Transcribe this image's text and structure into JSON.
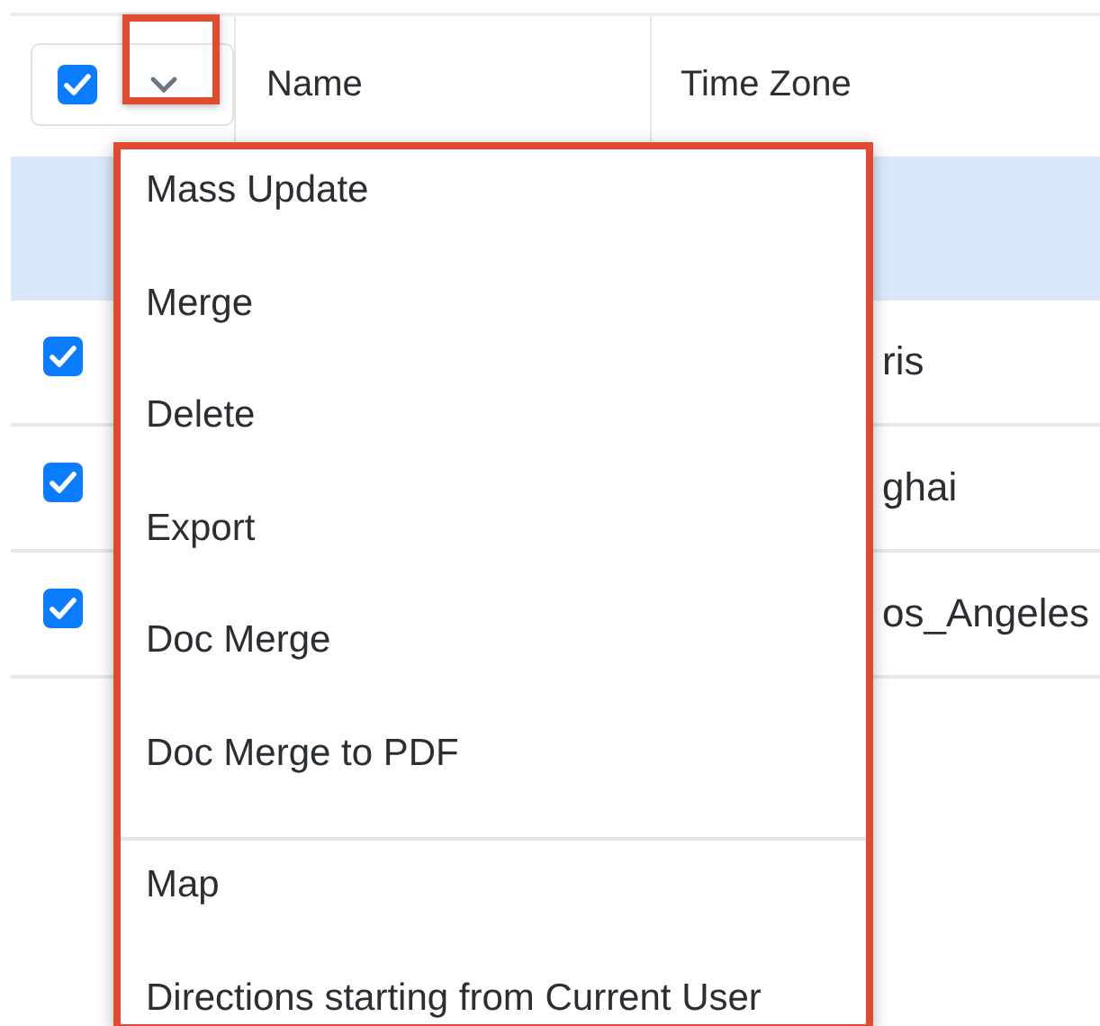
{
  "header": {
    "select_all": {
      "checked": true
    },
    "columns": [
      "Name",
      "Time Zone"
    ]
  },
  "rows": [
    {
      "selected": true
    },
    {
      "selected": false,
      "checked": true,
      "time_zone": "ris"
    },
    {
      "selected": false,
      "checked": true,
      "time_zone": "ghai"
    },
    {
      "selected": false,
      "checked": true,
      "time_zone": "os_Angeles"
    }
  ],
  "menu": {
    "sections": [
      {
        "items": [
          "Mass Update",
          "Merge",
          "Delete",
          "Export",
          "Doc Merge",
          "Doc Merge to PDF"
        ]
      },
      {
        "items": [
          "Map",
          "Directions starting from Current User"
        ]
      }
    ]
  }
}
